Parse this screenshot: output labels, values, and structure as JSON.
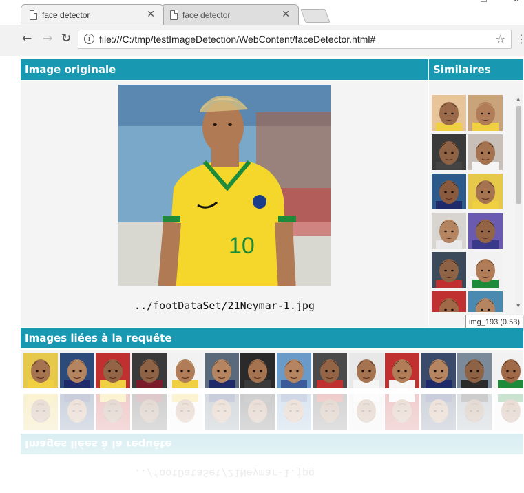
{
  "browser": {
    "tabs": [
      {
        "title": "face detector",
        "close": "✕"
      },
      {
        "title": "face detector",
        "close": "✕"
      }
    ],
    "window_controls": [
      "−",
      "☐",
      "✕"
    ],
    "url": "file:///C:/tmp/testImageDetection/WebContent/faceDetector.html#",
    "back_icon": "←",
    "forward_icon": "→",
    "reload_icon": "↻",
    "info_icon": "i",
    "star_icon": "☆",
    "menu_icon": "⋮"
  },
  "page": {
    "original_header": "Image originale",
    "similar_header": "Similaires",
    "related_header": "Images liées à la requête",
    "caption": "../footDataSet/21Neymar-1.jpg",
    "tooltip": "img_193 (0.53)"
  },
  "colors": {
    "header_bg": "#1998b1",
    "panel_bg": "#f4f4f4",
    "jersey": "#f4d72a",
    "jersey_trim": "#1e8b3a",
    "skin": "#b07a55"
  },
  "similar_thumbnails": [
    {
      "skin": "#9a6a4a",
      "bg": "#e8c49a",
      "hair": "#2a1a10",
      "shirt": "#f0d040"
    },
    {
      "skin": "#b07d58",
      "bg": "#c9a37a",
      "hair": "#d8c08a",
      "shirt": "#f0d040"
    },
    {
      "skin": "#8e6244",
      "bg": "#3a3a3a",
      "hair": "#1e140c",
      "shirt": "#444444"
    },
    {
      "skin": "#a57350",
      "bg": "#c8c0b8",
      "hair": "#1e140c",
      "shirt": "#f5f5f5"
    },
    {
      "skin": "#8a5a3e",
      "bg": "#2c5a8a",
      "hair": "#1e140c",
      "shirt": "#1e2a6a"
    },
    {
      "skin": "#a57350",
      "bg": "#e6c84a",
      "hair": "#3a2818",
      "shirt": "#f0d040"
    },
    {
      "skin": "#b58460",
      "bg": "#d8d4d0",
      "hair": "#2a1a10",
      "shirt": "#e8e8e8"
    },
    {
      "skin": "#936445",
      "bg": "#6a5ab0",
      "hair": "#1e140c",
      "shirt": "#3a3a8a"
    },
    {
      "skin": "#8e6244",
      "bg": "#3a4a5a",
      "hair": "#1e140c",
      "shirt": "#c03030"
    },
    {
      "skin": "#b07d58",
      "bg": "#f2f2f2",
      "hair": "#2a1a10",
      "shirt": "#1e8b3a"
    },
    {
      "skin": "#a06a48",
      "bg": "#c03030",
      "hair": "#2a1a10",
      "shirt": "#c03030"
    },
    {
      "skin": "#b58460",
      "bg": "#4a8ab0",
      "hair": "#2a1a10",
      "shirt": "#f5f5f5"
    }
  ],
  "related_thumbnails": [
    {
      "skin": "#a57350",
      "bg": "#e6c84a",
      "hair": "#2a1a10",
      "shirt": "#f0d040"
    },
    {
      "skin": "#b58460",
      "bg": "#2c4a7a",
      "hair": "#5a3a20",
      "shirt": "#1e2a6a"
    },
    {
      "skin": "#936445",
      "bg": "#c03030",
      "hair": "#1e140c",
      "shirt": "#f0d040"
    },
    {
      "skin": "#8e6244",
      "bg": "#3a3a3a",
      "hair": "#1e140c",
      "shirt": "#7a1a2a"
    },
    {
      "skin": "#b07d58",
      "bg": "#f2f2f2",
      "hair": "#d8c08a",
      "shirt": "#f0d040"
    },
    {
      "skin": "#b58460",
      "bg": "#5a6a7a",
      "hair": "#3a2818",
      "shirt": "#1e2a6a"
    },
    {
      "skin": "#a57350",
      "bg": "#2a2a2a",
      "hair": "#3a2818",
      "shirt": "#3a3a3a"
    },
    {
      "skin": "#b58460",
      "bg": "#6a9ac8",
      "hair": "#3a2818",
      "shirt": "#3a5a9a"
    },
    {
      "skin": "#936445",
      "bg": "#4a4a4a",
      "hair": "#1e140c",
      "shirt": "#c03030"
    },
    {
      "skin": "#a57350",
      "bg": "#e8e8e8",
      "hair": "#2a1a10",
      "shirt": "#f5f5f5"
    },
    {
      "skin": "#b07d58",
      "bg": "#c03030",
      "hair": "#2a1a10",
      "shirt": "#f5f5f5"
    },
    {
      "skin": "#b58460",
      "bg": "#3a4a6a",
      "hair": "#3a2818",
      "shirt": "#1e2a6a"
    },
    {
      "skin": "#8e6244",
      "bg": "#7a8a9a",
      "hair": "#1e140c",
      "shirt": "#2a2a2a"
    },
    {
      "skin": "#a06a48",
      "bg": "#f2f2f2",
      "hair": "#1e140c",
      "shirt": "#1e8b3a"
    }
  ]
}
